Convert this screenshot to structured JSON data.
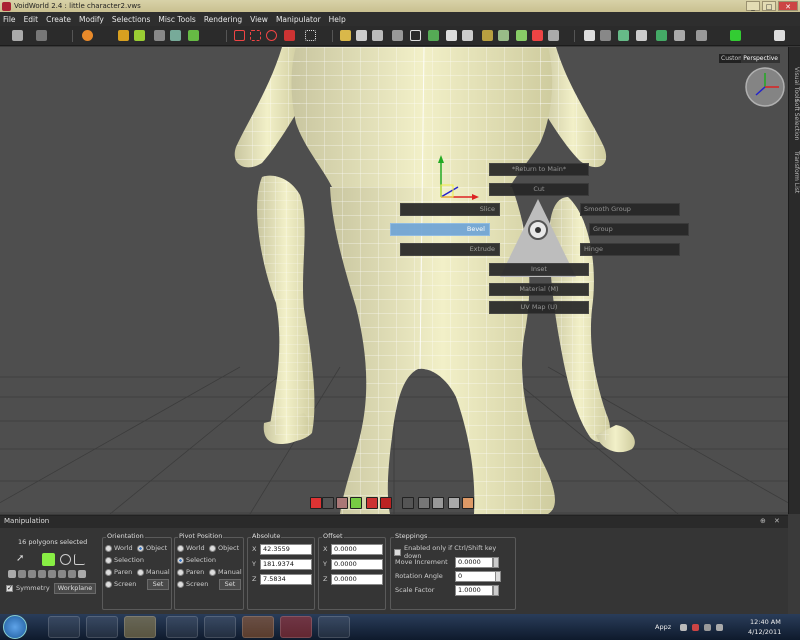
{
  "window": {
    "title": "VoidWorld 2.4 : little character2.vws",
    "minimize": "_",
    "maximize": "□",
    "close": "✕"
  },
  "menu": [
    "File",
    "Edit",
    "Create",
    "Modify",
    "Selections",
    "Misc Tools",
    "Rendering",
    "View",
    "Manipulator",
    "Help"
  ],
  "viewport": {
    "custom_label": "Custom",
    "view_label": "Perspective",
    "side_tabs": [
      "Visual Tools",
      "Soft Selection",
      "Transform List"
    ]
  },
  "radial_menu": {
    "top": [
      "*Return to Main*",
      "Cut"
    ],
    "left": [
      "Slice",
      "Bevel",
      "Extrude"
    ],
    "right": [
      "Smooth Group",
      "Group",
      "Hinge"
    ],
    "bottom": [
      "Inset",
      "Material    (M)",
      "UV Map    (U)"
    ],
    "active": "Bevel"
  },
  "panel": {
    "title": "Manipulation",
    "pin": "⊕",
    "close": "✕",
    "status": "16 polygons selected",
    "symmetry": "Symmetry",
    "workplane": "Workplane",
    "orientation": {
      "title": "Orientation",
      "world": "World",
      "object": "Object",
      "selection": "Selection",
      "parent": "Paren",
      "manual": "Manual",
      "screen": "Screen",
      "set": "Set"
    },
    "pivot": {
      "title": "Pivot Position",
      "world": "World",
      "object": "Object",
      "selection": "Selection",
      "parent": "Paren",
      "manual": "Manual",
      "screen": "Screen",
      "set": "Set"
    },
    "absolute": {
      "title": "Absolute",
      "x_label": "X",
      "y_label": "Y",
      "z_label": "Z",
      "x": "42.3559",
      "y": "181.9374",
      "z": "7.5834"
    },
    "offset": {
      "title": "Offset",
      "x_label": "X",
      "y_label": "Y",
      "z_label": "Z",
      "x": "0.0000",
      "y": "0.0000",
      "z": "0.0000"
    },
    "steppings": {
      "title": "Steppings",
      "enabled_label": "Enabled only if Ctrl/Shift key down",
      "move_label": "Move Increment",
      "move_value": "0.0000",
      "rotation_label": "Rotation Angle",
      "rotation_value": "0",
      "scale_label": "Scale Factor",
      "scale_value": "1.0000"
    }
  },
  "taskbar": {
    "appz": "Appz",
    "time": "12:40 AM",
    "date": "4/12/2011"
  }
}
